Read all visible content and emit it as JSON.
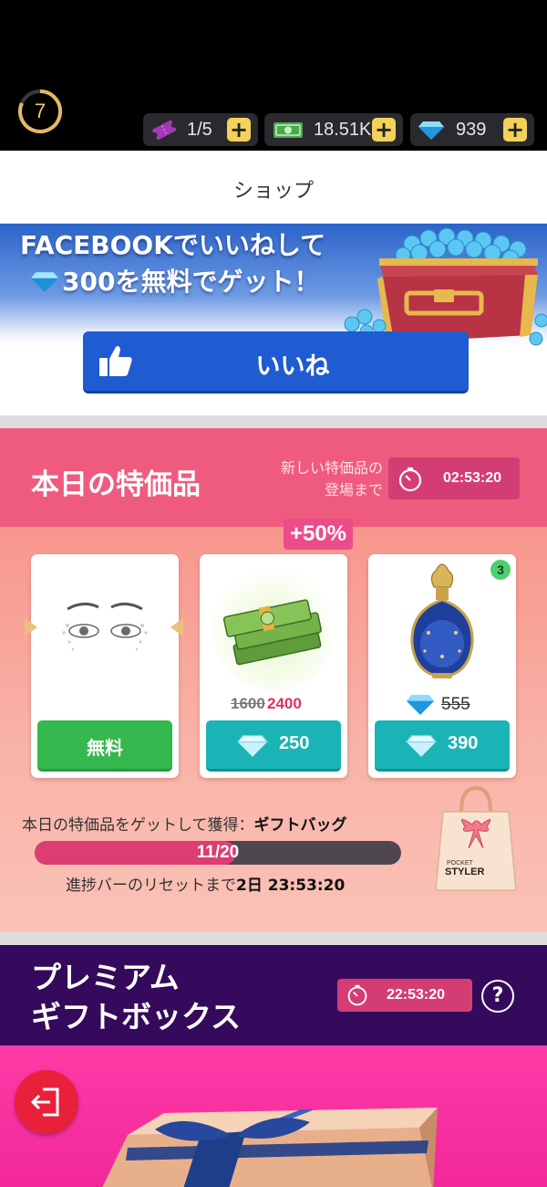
{
  "status_bar": {
    "level": "7",
    "tickets": "1/5",
    "cash": "18.51K",
    "gems": "939",
    "plus": "+"
  },
  "header": {
    "title": "ショップ"
  },
  "facebook_banner": {
    "line1": "FACEBOOKでいいねして",
    "line2": "300を無料でゲット！",
    "like_button": "いいね"
  },
  "daily_deals": {
    "title": "本日の特価品",
    "next_label_line1": "新しい特価品の",
    "next_label_line2": "登場まで",
    "timer": "02:53:20",
    "items": [
      {
        "name": "eye-makeup",
        "button": "無料"
      },
      {
        "name": "cash-bundle",
        "badge": "+50%",
        "old_amount": "1600",
        "new_amount": "2400",
        "price": "250"
      },
      {
        "name": "perfume",
        "quantity": "3",
        "old_price": "555",
        "price": "390"
      }
    ],
    "progress_label": "本日の特価品をゲットして獲得：",
    "reward_name": "ギフトバッグ",
    "progress_current": 11,
    "progress_total": 20,
    "progress_text": "11/20",
    "reset_label": "進捗バーのリセットまで",
    "reset_time": "2日 23:53:20",
    "bag_brand_line1": "POCKET",
    "bag_brand_line2": "STYLER"
  },
  "premium": {
    "title_line1": "プレミアム",
    "title_line2": "ギフトボックス",
    "timer": "22:53:20",
    "help": "?"
  },
  "colors": {
    "accent_pink": "#ef5b7e",
    "facebook_blue": "#1f5bd1",
    "buy_green": "#35b84d",
    "buy_teal": "#1bb4b6",
    "premium_purple": "#350a5c"
  }
}
